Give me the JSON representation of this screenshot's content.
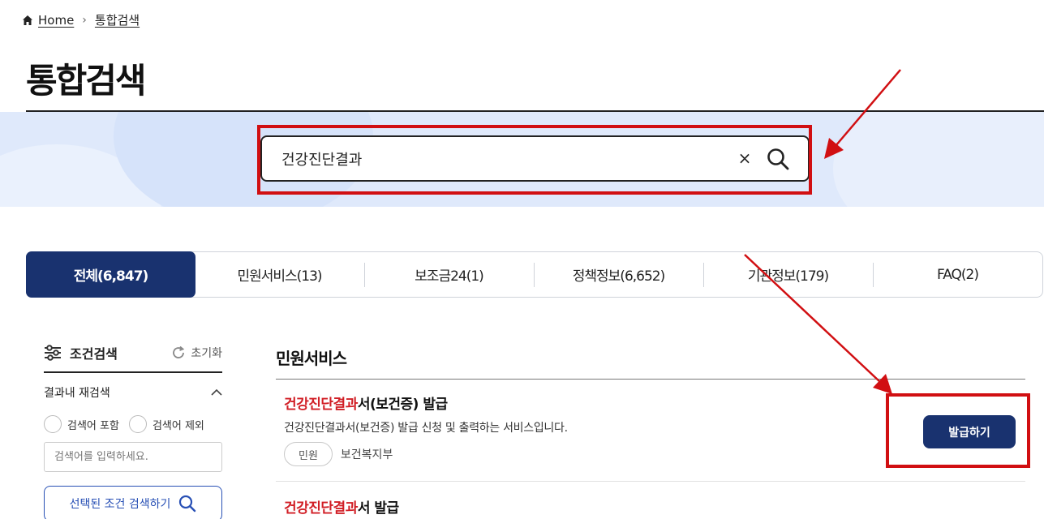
{
  "breadcrumb": {
    "home": "Home",
    "current": "통합검색"
  },
  "page_title": "통합검색",
  "search": {
    "value": "건강진단결과",
    "clear_label": "×"
  },
  "tabs": [
    {
      "label": "전체(6,847)",
      "active": true
    },
    {
      "label": "민원서비스(13)",
      "active": false
    },
    {
      "label": "보조금24(1)",
      "active": false
    },
    {
      "label": "정책정보(6,652)",
      "active": false
    },
    {
      "label": "기관정보(179)",
      "active": false
    },
    {
      "label": "FAQ(2)",
      "active": false
    }
  ],
  "sidebar": {
    "title": "조건검색",
    "reset": "초기화",
    "re_search_label": "결과내 재검색",
    "include_label": "검색어 포함",
    "exclude_label": "검색어 제외",
    "input_placeholder": "검색어를 입력하세요.",
    "submit_label": "선택된 조건 검색하기"
  },
  "main": {
    "section_title": "민원서비스",
    "results": [
      {
        "title_hit": "건강진단결과",
        "title_rest": "서(보건증) 발급",
        "desc": "건강진단결과서(보건증) 발급 신청 및 출력하는 서비스입니다.",
        "badge": "민원",
        "agency": "보건복지부",
        "action": "발급하기"
      },
      {
        "title_hit": "건강진단결과",
        "title_rest": "서 발급"
      }
    ]
  },
  "colors": {
    "accent": "#19326f",
    "highlight": "#d11e25",
    "annotation": "#d10f12"
  }
}
